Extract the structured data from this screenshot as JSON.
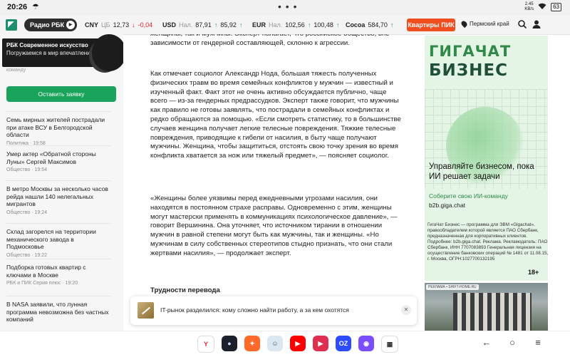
{
  "status_bar": {
    "time": "20:26",
    "kbps_value": "2.45",
    "kbps_unit": "KB/s",
    "battery": "63"
  },
  "topbar": {
    "radio_label": "Радио РБК",
    "tickers": [
      {
        "code": "CNY",
        "sub": "ЦБ",
        "value": "12,73",
        "change": "-0,04"
      },
      {
        "code": "USD",
        "sub": "Нал.",
        "value": "87,91",
        "arrow": "↑",
        "value2": "85,92",
        "arrow2": "↑"
      },
      {
        "code": "EUR",
        "sub": "Нал.",
        "value": "102,56",
        "arrow": "↑",
        "value2": "100,48",
        "arrow2": "↑"
      },
      {
        "code": "Сосоа",
        "value": "584,70",
        "arrow": "↑"
      }
    ],
    "pik_button": "Квартиры ПИК",
    "region": "Пермский край"
  },
  "sidebar": {
    "banner_line1": "РБК Современное искусство",
    "banner_line2": "Погружаемся в мир впечатлений",
    "cut_text": "команду",
    "cta_button": "Оставить заявку",
    "news": [
      {
        "title": "Семь мирных жителей пострадали при атаке ВСУ в Белгородской области",
        "rubric": "Политика",
        "time": "19:58"
      },
      {
        "title": "Умер актер «Обратной стороны Луны» Сергей Максимов",
        "rubric": "Общество",
        "time": "19:54"
      },
      {
        "title": "В метро Москвы за несколько часов рейда нашли 140 нелегальных мигрантов",
        "rubric": "Общество",
        "time": "19:24"
      },
      {
        "title": "Склад загорелся на территории механического завода в Подмосковье",
        "rubric": "Общество",
        "time": "19:22"
      },
      {
        "title": "Подборка готовых квартир с ключами в Москве",
        "rubric": "РБК и ПИК Серия плюс",
        "time": "19:20"
      },
      {
        "title": "В NASA заявили, что лунная программа невозможна без частных компаний",
        "rubric": "",
        "time": ""
      }
    ]
  },
  "article": {
    "p1": "женщины, так и мужчины. Эксперт полагает, что российское общество, вне зависимости от гендерной составляющей, склонно к агрессии.",
    "p2": "Как отмечает социолог Александр Нода, большая тяжесть полученных физических травм во время семейных конфликтов у мужчин — известный и изученный факт. Факт этот не очень активно обсуждается публично, чаще всего — из-за гендерных предрассудков. Эксперт также говорит, что мужчины как правило не готовы заявлять, что пострадали в семейных конфликтах и редко обращаются за помощью. «Если смотреть статистику, то в большинстве случаев женщина получает легкие телесные повреждения. Тяжкие телесные повреждения, приводящие к гибели от насилия, в быту чаще получают мужчины. Женщина, чтобы защититься, отстоять свою точку зрения во время конфликта хватается за нож или тяжелый предмет», — поясняет социолог.",
    "p3": "«Женщины более уязвимы перед ежедневными угрозами насилия, они находятся в постоянном страхе расправы. Одновременно с этим, женщины могут мастерски применять в коммуникациях психологическое давление», — говорит Вершинина. Она уточняет, что источником тирании в отношении мужчин в равной степени могут быть как мужчины, так и женщины. «Но мужчинам в силу собственных стереотипов стыдно признать, что они стали жертвами насилия», — продолжает эксперт.",
    "subheading": "Трудности перевода"
  },
  "popup": {
    "text": "IT-рынок разделился: кому сложно найти работу, а за кем охотятся"
  },
  "ad": {
    "brand_line1": "ГИГАЧАТ",
    "brand_line2": "БИЗНЕС",
    "headline": "Управляйте бизнесом, пока ИИ решает задачи",
    "subtext": "Соберите свою ИИ-команду",
    "url": "b2b.giga.chat",
    "legal": "ГигаЧат Бизнес — программа для ЭВМ «Gigachat», правообладателем которой является ПАО Сбербанк, предназначенная для корпоративных клиентов. Подробнее: b2b.giga.chat. Реклама. Рекламодатель: ПАО Сбербанк, ИНН 7707083893 Генеральная лицензия на осуществление банковских операций № 1481 от 11.08.15, г. Москва, ОГРН:1027700132195",
    "age": "18+",
    "ad2_tag": "РЕКЛАМА • SHIFT-HOME.RU"
  },
  "dock_apps": [
    {
      "name": "yandex",
      "label": "Y",
      "color": "#ffffff",
      "fg": "#e8232e"
    },
    {
      "name": "camera",
      "label": "●",
      "color": "#1b1f2b",
      "fg": "#cfd6ff"
    },
    {
      "name": "puzzle-game",
      "label": "✦",
      "color": "#ff6a2b",
      "fg": "#ffffff"
    },
    {
      "name": "chat-cat",
      "label": "☺",
      "color": "#dbe8f2",
      "fg": "#445566"
    },
    {
      "name": "youtube",
      "label": "▶",
      "color": "#ff0000",
      "fg": "#ffffff"
    },
    {
      "name": "rutube",
      "label": "▶",
      "color": "#e02e50",
      "fg": "#ffffff"
    },
    {
      "name": "ozon",
      "label": "OZ",
      "color": "#2b4cff",
      "fg": "#ffffff"
    },
    {
      "name": "messenger",
      "label": "◉",
      "color": "#7a4dff",
      "fg": "#ffffff"
    },
    {
      "name": "all-apps",
      "label": "▦",
      "color": "#ffffff",
      "fg": "#333333"
    }
  ]
}
